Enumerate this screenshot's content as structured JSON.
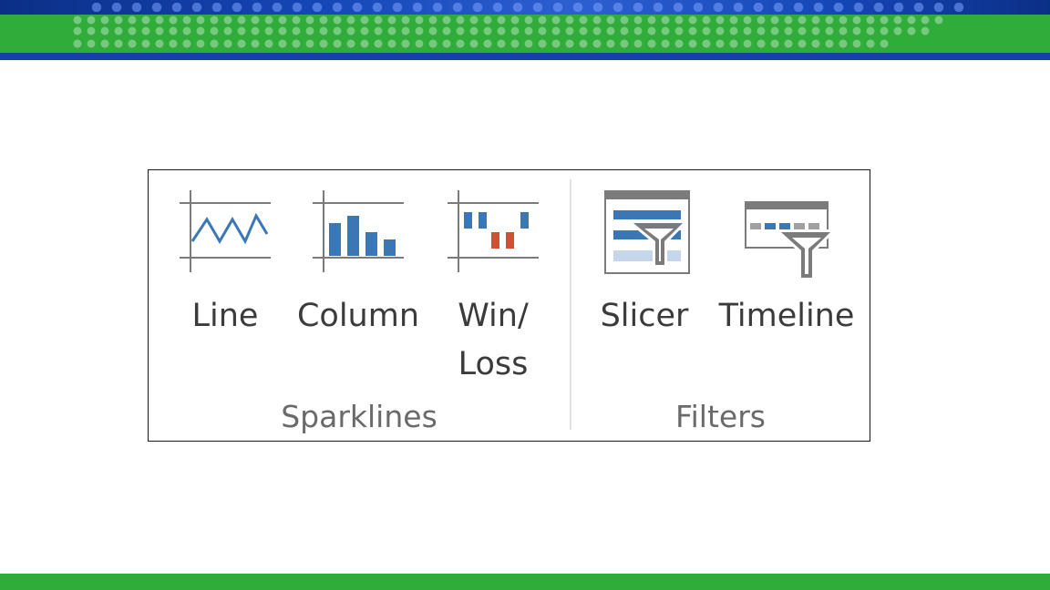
{
  "ribbon": {
    "groups": [
      {
        "label": "Sparklines",
        "buttons": [
          {
            "label": "Line",
            "icon": "line-sparkline-icon"
          },
          {
            "label": "Column",
            "icon": "column-sparkline-icon"
          },
          {
            "label": "Win/\nLoss",
            "icon": "win-loss-sparkline-icon"
          }
        ]
      },
      {
        "label": "Filters",
        "buttons": [
          {
            "label": "Slicer",
            "icon": "slicer-icon"
          },
          {
            "label": "Timeline",
            "icon": "timeline-icon"
          }
        ]
      }
    ]
  },
  "colors": {
    "accent_blue": "#3b77b5",
    "loss_red": "#d0512e",
    "icon_gray": "#7b7b7b",
    "banner_green": "#2fac3a",
    "banner_blue": "#1a3fa6"
  }
}
